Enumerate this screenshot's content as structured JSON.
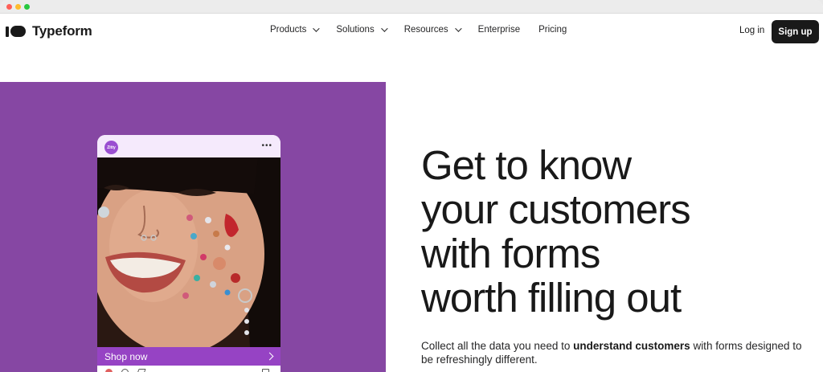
{
  "nav": {
    "brand": "Typeform",
    "menu": [
      {
        "label": "Products",
        "dropdown": true
      },
      {
        "label": "Solutions",
        "dropdown": true
      },
      {
        "label": "Resources",
        "dropdown": true
      },
      {
        "label": "Enterprise",
        "dropdown": false
      },
      {
        "label": "Pricing",
        "dropdown": false
      }
    ],
    "login_label": "Log in",
    "signup_label": "Sign up"
  },
  "hero": {
    "headline": [
      "Get to know",
      "your customers",
      "with forms",
      "worth filling out"
    ],
    "sub_before": "Collect all the data you need to ",
    "sub_bold": "understand customers",
    "sub_after": " with forms designed to be refreshingly different."
  },
  "phone_card": {
    "avatar_text": "Zitty",
    "menu_dots": "•••",
    "cta_label": "Shop now"
  },
  "colors": {
    "hero_bg": "#8647a3",
    "cta_bar": "#9643c4",
    "primary_button": "#191919"
  }
}
